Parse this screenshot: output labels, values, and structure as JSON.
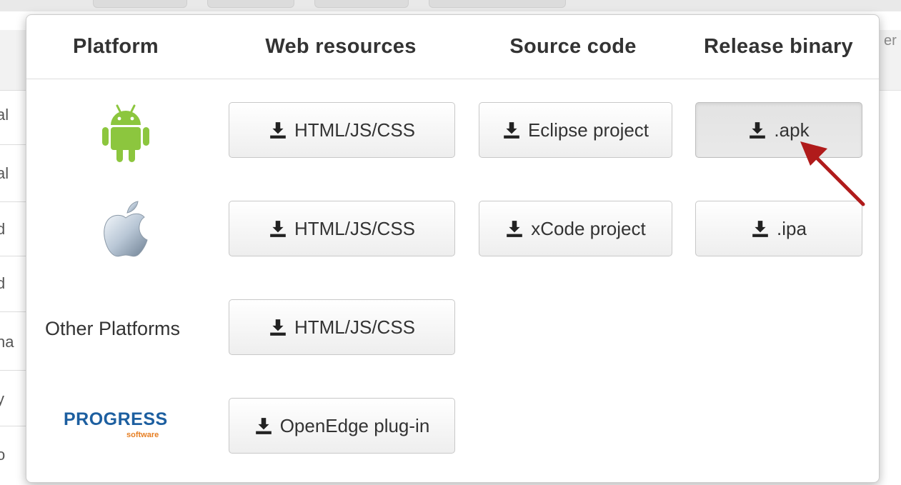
{
  "background": {
    "right_fragment": "er",
    "left_fragments": [
      "al",
      "al",
      "d",
      "d",
      "na",
      "y",
      "o"
    ]
  },
  "table": {
    "headers": {
      "platform": "Platform",
      "web_resources": "Web resources",
      "source_code": "Source code",
      "release_binary": "Release binary"
    },
    "rows": {
      "android": {
        "web": "HTML/JS/CSS",
        "source": "Eclipse project",
        "binary": ".apk"
      },
      "ios": {
        "web": "HTML/JS/CSS",
        "source": "xCode project",
        "binary": ".ipa"
      },
      "other": {
        "label": "Other Platforms",
        "web": "HTML/JS/CSS"
      },
      "progress": {
        "logo_main": "PROGRESS",
        "logo_sub": "software",
        "web": "OpenEdge plug-in"
      }
    }
  },
  "icons": {
    "download": "download-icon",
    "android": "android-icon",
    "apple": "apple-icon"
  },
  "colors": {
    "android_green": "#8cc63e",
    "progress_blue": "#1d5fa0",
    "progress_orange": "#e67e22",
    "arrow_red": "#b01b1b"
  }
}
